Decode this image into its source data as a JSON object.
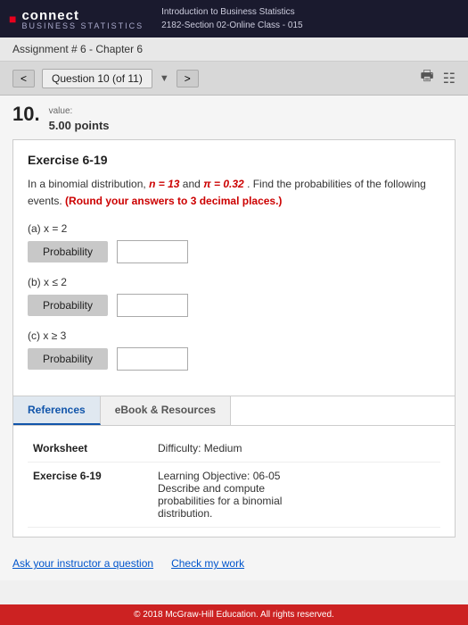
{
  "header": {
    "logo_icon": "E",
    "logo_text": "connect",
    "logo_sub": "BUSINESS STATISTICS",
    "course_line1": "Introduction to Business Statistics",
    "course_line2": "2182-Section 02-Online Class - 015"
  },
  "assignment_bar": {
    "label": "Assignment # 6 - Chapter 6"
  },
  "question_nav": {
    "prev_label": "<",
    "next_label": ">",
    "question_label": "Question 10 (of 11)"
  },
  "question": {
    "number": "10.",
    "value_label": "value:",
    "points": "5.00 points"
  },
  "exercise": {
    "title": "Exercise 6-19",
    "description_part1": "In a binomial distribution, ",
    "n_val": "n = 13",
    "desc_and": " and ",
    "pi_val": "π = 0.32",
    "description_part2": ". Find the probabilities of the following events. ",
    "round_note": "(Round your answers to 3 decimal places.)",
    "sub_a_label": "(a) x = 2",
    "sub_b_label": "(b) x ≤ 2",
    "sub_c_label": "(c) x ≥ 3",
    "prob_label": "Probability",
    "input_a_value": "",
    "input_b_value": "",
    "input_c_value": ""
  },
  "references": {
    "tab_references": "References",
    "tab_ebook": "eBook & Resources",
    "worksheet_label": "Worksheet",
    "worksheet_value": "Difficulty: Medium",
    "exercise_label": "Exercise 6-19",
    "exercise_value_line1": "Learning Objective: 06-05",
    "exercise_value_line2": "Describe and compute",
    "exercise_value_line3": "probabilities for a binomial",
    "exercise_value_line4": "distribution."
  },
  "bottom_links": {
    "ask_instructor": "Ask your instructor a question",
    "check_work": "Check my work"
  },
  "footer": {
    "text": "© 2018 McGraw-Hill Education. All rights reserved."
  }
}
